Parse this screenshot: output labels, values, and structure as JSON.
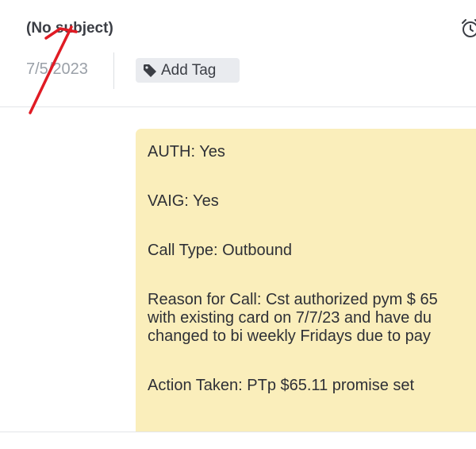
{
  "header": {
    "subject": "(No subject)",
    "date": "7/5/2023",
    "add_tag_label": "Add Tag",
    "icons": {
      "alarm": "alarm-clock-icon",
      "tag": "tag-icon"
    }
  },
  "note": {
    "background_color": "#faeebb",
    "lines": {
      "auth": "AUTH: Yes",
      "vaig": "VAIG: Yes",
      "call_type": "Call Type: Outbound",
      "reason_1": "Reason for Call: Cst authorized pym $ 65",
      "reason_2": "with existing card on 7/7/23 and have du",
      "reason_3": "changed to bi weekly Fridays due to pay",
      "action": "Action Taken: PTp $65.11 promise set"
    }
  },
  "annotation": {
    "type": "red-arrow",
    "color": "#e01b24"
  }
}
